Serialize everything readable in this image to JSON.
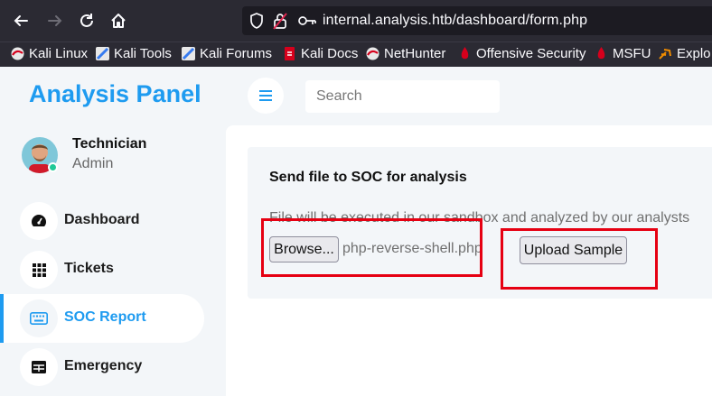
{
  "browser": {
    "url": "internal.analysis.htb/dashboard/form.php",
    "bookmarks": [
      {
        "label": "Kali Linux",
        "icon": "kali-icon"
      },
      {
        "label": "Kali Tools",
        "icon": "kali-icon"
      },
      {
        "label": "Kali Forums",
        "icon": "kali-icon"
      },
      {
        "label": "Kali Docs",
        "icon": "kali-docs-icon"
      },
      {
        "label": "NetHunter",
        "icon": "kali-icon"
      },
      {
        "label": "Offensive Security",
        "icon": "offsec-icon"
      },
      {
        "label": "MSFU",
        "icon": "offsec-icon"
      },
      {
        "label": "Explo",
        "icon": "exploit-db-icon"
      }
    ]
  },
  "sidebar": {
    "brand": "Analysis Panel",
    "user": {
      "name": "Technician",
      "role": "Admin"
    },
    "items": [
      {
        "label": "Dashboard",
        "icon": "dashboard-icon"
      },
      {
        "label": "Tickets",
        "icon": "grid-icon"
      },
      {
        "label": "SOC Report",
        "icon": "keyboard-icon",
        "active": true
      },
      {
        "label": "Emergency",
        "icon": "table-icon"
      }
    ]
  },
  "header": {
    "search_placeholder": "Search"
  },
  "form": {
    "title": "Send file to SOC for analysis",
    "description": "File will be executed in our sandbox and analyzed by our analysts",
    "browse_label": "Browse...",
    "file_name": "php-reverse-shell.php",
    "upload_label": "Upload Sample"
  },
  "colors": {
    "accent": "#1e9bf0",
    "highlight": "#e60012",
    "browser_chrome": "#2b2a33"
  }
}
